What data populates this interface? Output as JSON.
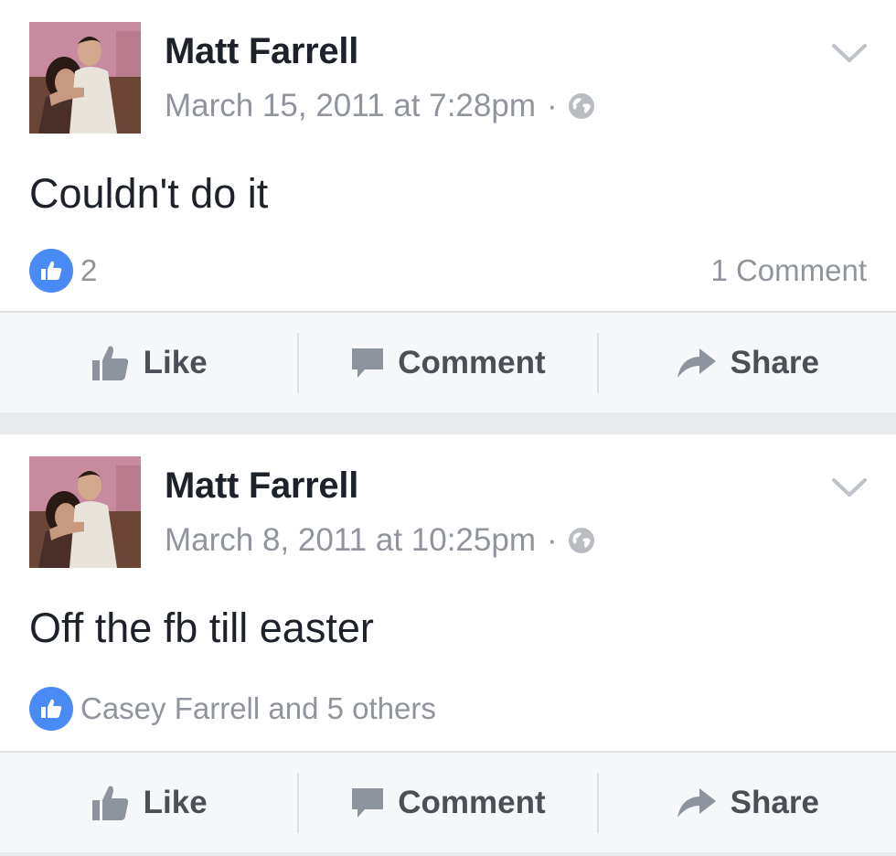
{
  "posts": [
    {
      "author": "Matt Farrell",
      "timestamp": "March 15, 2011 at 7:28pm",
      "separator": "·",
      "text": "Couldn't do it",
      "reaction_count": "2",
      "reaction_names": "",
      "comment_count": "1 Comment"
    },
    {
      "author": "Matt Farrell",
      "timestamp": "March 8, 2011 at 10:25pm",
      "separator": "·",
      "text": "Off the fb till easter",
      "reaction_count": "",
      "reaction_names": "Casey Farrell and 5 others",
      "comment_count": ""
    }
  ],
  "actions": {
    "like": "Like",
    "comment": "Comment",
    "share": "Share"
  },
  "icons": {
    "privacy": "globe-icon",
    "menu": "chevron-down-icon",
    "like_badge": "thumbs-up-icon",
    "share": "share-arrow-icon",
    "comment": "speech-bubble-icon"
  },
  "colors": {
    "brand_blue": "#4a8af4",
    "text_primary": "#1d2129",
    "text_secondary": "#90949c",
    "action_text": "#4b4f56"
  }
}
